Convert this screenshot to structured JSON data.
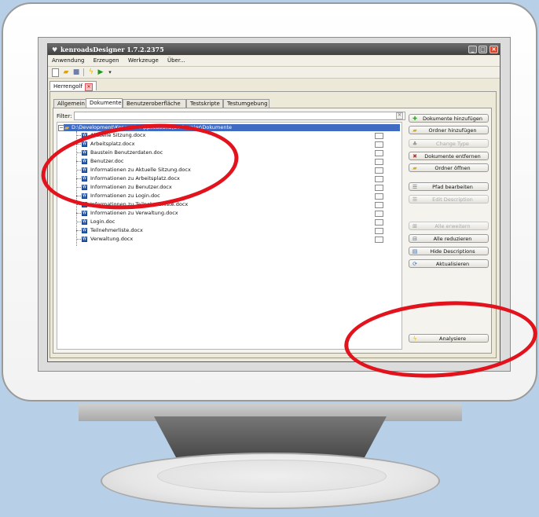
{
  "window": {
    "title": "kenroadsDesigner 1.7.2.2375",
    "controls": {
      "minimize": "_",
      "maximize": "□",
      "close": "✕"
    }
  },
  "menu": [
    "Anwendung",
    "Erzeugen",
    "Werkzeuge",
    "Über..."
  ],
  "toolbar_icons": [
    "new-icon",
    "open-folder-icon",
    "save-icon",
    "lightning-icon",
    "run-icon",
    "dropdown-icon"
  ],
  "doc_tab": {
    "label": "Herrengolf"
  },
  "tabs": [
    "Allgemein",
    "Dokumente",
    "Benutzeroberfläche",
    "Testskripte",
    "Testumgebung"
  ],
  "active_tab": "Dokumente",
  "filter": {
    "label": "Filter:",
    "value": ""
  },
  "tree": {
    "root": "D:\\Development\\Kenroads.Applications\\Golfturnier\\Dokumente",
    "files": [
      "Aktuelle Sitzung.docx",
      "Arbeitsplatz.docx",
      "Baustein Benutzerdaten.doc",
      "Benutzer.doc",
      "Informationen zu Aktuelle Sitzung.docx",
      "Informationen zu Arbeitsplatz.docx",
      "Informationen zu Benutzer.docx",
      "Informationen zu Login.doc",
      "Informationen zu Teilnehmerliste.docx",
      "Informationen zu Verwaltung.docx",
      "Login.doc",
      "Teilnehmerliste.docx",
      "Verwaltung.docx"
    ]
  },
  "buttons": {
    "add_documents": "Dokumente hinzufügen",
    "add_folder": "Ordner hinzufügen",
    "change_type": "Change Type",
    "remove_documents": "Dokumente entfernen",
    "open_folder": "Ordner öffnen",
    "edit_path": "Pfad bearbeiten",
    "edit_description": "Edit Description",
    "expand_all": "Alle erweitern",
    "collapse_all": "Alle reduzieren",
    "hide_descriptions": "Hide Descriptions",
    "refresh": "Aktualisieren",
    "analyze": "Analysiere"
  },
  "colors": {
    "selection": "#3f6bc3",
    "annotation_ring": "#e2131c",
    "background": "#b7d0e8"
  }
}
